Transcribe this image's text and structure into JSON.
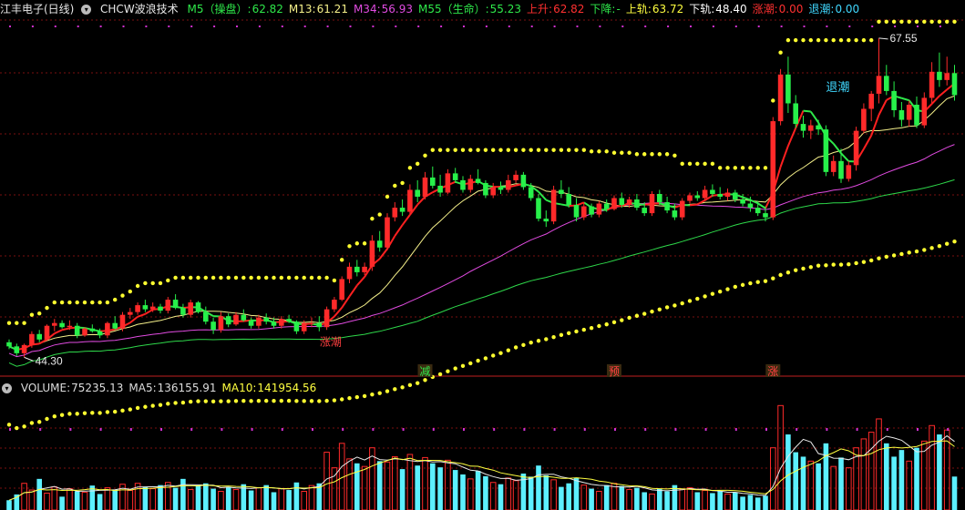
{
  "header": {
    "stock_name": "江丰电子(日线)",
    "indicator_name": "CHCW波浪技术",
    "items": [
      {
        "label": "M5（操盘）:",
        "value": "62.82",
        "color": "#2ee84a"
      },
      {
        "label": "M13:",
        "value": "61.21",
        "color": "#f5f08a"
      },
      {
        "label": "M34:",
        "value": "56.93",
        "color": "#e14be1"
      },
      {
        "label": "M55（生命）:",
        "value": "55.23",
        "color": "#2ee84a"
      },
      {
        "label": "上升:",
        "value": "62.82",
        "color": "#ff3030"
      },
      {
        "label": "下降:",
        "value": "-",
        "color": "#2ee84a"
      },
      {
        "label": "上轨:",
        "value": "63.72",
        "color": "#ffff40"
      },
      {
        "label": "下轨:",
        "value": "48.40",
        "color": "#ffffff"
      },
      {
        "label": "涨潮:",
        "value": "0.00",
        "color": "#ff3030"
      },
      {
        "label": "退潮:",
        "value": "0.00",
        "color": "#40d8ff"
      }
    ]
  },
  "volume_header": {
    "items": [
      {
        "label": "VOLUME:",
        "value": "75235.13",
        "color": "#dddddd"
      },
      {
        "label": "MA5:",
        "value": "136155.91",
        "color": "#dddddd"
      },
      {
        "label": "MA10:",
        "value": "141954.56",
        "color": "#ffff40"
      }
    ]
  },
  "annotations": {
    "high": "67.55",
    "low": "44.30",
    "tide_out": "退潮",
    "tide_in": "涨潮",
    "markers": [
      {
        "text": "减",
        "color": "#2ee84a",
        "index": 55
      },
      {
        "text": "预",
        "color": "#ff4040",
        "index": 80
      },
      {
        "text": "涨",
        "color": "#ff4040",
        "index": 101
      }
    ]
  },
  "colors": {
    "up": "#ff2a2a",
    "down": "#27f04a",
    "vol_up": "#ff2a2a",
    "vol_down": "#5cf0ff",
    "grid": "#7a1010"
  },
  "chart_data": {
    "type": "candlestick",
    "ylim": [
      43,
      69
    ],
    "volume_ylim": [
      0,
      250000
    ],
    "ohlc": [
      [
        45.4,
        45.6,
        44.9,
        45.1
      ],
      [
        45.1,
        45.3,
        44.4,
        44.6
      ],
      [
        44.6,
        45.3,
        44.3,
        45.2
      ],
      [
        45.2,
        46.2,
        45.0,
        46.0
      ],
      [
        46.0,
        46.3,
        45.4,
        45.6
      ],
      [
        45.6,
        46.7,
        45.5,
        46.6
      ],
      [
        46.6,
        47.1,
        46.2,
        46.8
      ],
      [
        46.8,
        47.0,
        46.4,
        46.5
      ],
      [
        46.5,
        47.0,
        46.3,
        46.6
      ],
      [
        46.6,
        46.8,
        45.7,
        45.9
      ],
      [
        45.9,
        46.5,
        45.8,
        46.4
      ],
      [
        46.4,
        46.7,
        46.1,
        46.2
      ],
      [
        46.2,
        46.4,
        45.7,
        45.9
      ],
      [
        45.9,
        46.9,
        45.7,
        46.8
      ],
      [
        46.8,
        47.3,
        46.3,
        46.4
      ],
      [
        46.4,
        47.6,
        46.2,
        47.4
      ],
      [
        47.4,
        47.9,
        47.1,
        47.6
      ],
      [
        47.6,
        48.3,
        47.4,
        48.1
      ],
      [
        48.1,
        48.5,
        47.6,
        47.8
      ],
      [
        47.8,
        48.3,
        47.6,
        48.0
      ],
      [
        48.0,
        48.2,
        47.5,
        47.7
      ],
      [
        47.7,
        48.7,
        47.5,
        48.5
      ],
      [
        48.5,
        48.9,
        47.8,
        47.9
      ],
      [
        47.9,
        48.2,
        47.2,
        47.4
      ],
      [
        47.4,
        48.5,
        47.2,
        48.3
      ],
      [
        48.3,
        48.4,
        47.5,
        47.6
      ],
      [
        47.6,
        48.0,
        46.7,
        46.9
      ],
      [
        46.9,
        47.2,
        46.0,
        46.3
      ],
      [
        46.3,
        47.6,
        46.1,
        47.3
      ],
      [
        47.3,
        47.5,
        46.5,
        46.7
      ],
      [
        46.7,
        47.6,
        46.6,
        47.4
      ],
      [
        47.4,
        47.8,
        46.9,
        47.0
      ],
      [
        47.0,
        47.2,
        46.4,
        46.6
      ],
      [
        46.6,
        47.4,
        46.4,
        47.2
      ],
      [
        47.2,
        47.5,
        46.7,
        46.9
      ],
      [
        46.9,
        47.2,
        46.4,
        46.6
      ],
      [
        46.6,
        47.3,
        46.4,
        47.1
      ],
      [
        47.1,
        47.4,
        46.8,
        46.9
      ],
      [
        46.9,
        47.0,
        46.0,
        46.2
      ],
      [
        46.2,
        47.0,
        46.0,
        46.8
      ],
      [
        46.8,
        47.2,
        46.5,
        46.8
      ],
      [
        46.8,
        47.3,
        46.2,
        46.5
      ],
      [
        46.5,
        48.0,
        46.3,
        47.8
      ],
      [
        47.8,
        48.7,
        47.6,
        48.5
      ],
      [
        48.5,
        50.2,
        48.4,
        50.0
      ],
      [
        50.0,
        51.2,
        49.7,
        50.9
      ],
      [
        50.9,
        51.4,
        50.2,
        50.5
      ],
      [
        50.5,
        51.2,
        50.3,
        50.9
      ],
      [
        50.9,
        53.2,
        50.6,
        52.8
      ],
      [
        52.8,
        53.5,
        52.0,
        52.3
      ],
      [
        52.3,
        54.8,
        52.1,
        54.5
      ],
      [
        54.5,
        55.6,
        54.2,
        55.2
      ],
      [
        55.2,
        55.8,
        54.6,
        54.9
      ],
      [
        54.9,
        56.9,
        54.7,
        56.5
      ],
      [
        56.5,
        57.2,
        55.6,
        56.0
      ],
      [
        56.0,
        57.8,
        55.8,
        57.4
      ],
      [
        57.4,
        58.2,
        56.6,
        56.8
      ],
      [
        56.8,
        57.6,
        56.0,
        56.3
      ],
      [
        56.3,
        58.0,
        56.2,
        57.7
      ],
      [
        57.7,
        58.1,
        57.0,
        57.2
      ],
      [
        57.2,
        57.5,
        56.3,
        56.5
      ],
      [
        56.5,
        57.6,
        56.3,
        57.3
      ],
      [
        57.3,
        58.0,
        56.9,
        57.0
      ],
      [
        57.0,
        57.2,
        55.9,
        56.1
      ],
      [
        56.1,
        57.0,
        55.9,
        56.7
      ],
      [
        56.7,
        57.1,
        56.2,
        56.5
      ],
      [
        56.5,
        57.6,
        56.3,
        57.2
      ],
      [
        57.2,
        57.9,
        57.0,
        57.6
      ],
      [
        57.6,
        57.8,
        56.5,
        56.7
      ],
      [
        56.7,
        57.0,
        55.7,
        55.9
      ],
      [
        55.9,
        56.2,
        54.2,
        54.4
      ],
      [
        54.4,
        55.0,
        53.8,
        54.2
      ],
      [
        54.2,
        56.8,
        54.0,
        56.5
      ],
      [
        56.5,
        57.2,
        55.9,
        56.2
      ],
      [
        56.2,
        56.7,
        55.2,
        55.4
      ],
      [
        55.4,
        55.9,
        54.2,
        54.5
      ],
      [
        54.5,
        55.6,
        54.3,
        55.3
      ],
      [
        55.3,
        55.5,
        54.5,
        54.7
      ],
      [
        54.7,
        55.7,
        54.5,
        55.5
      ],
      [
        55.5,
        55.8,
        54.9,
        55.1
      ],
      [
        55.1,
        56.1,
        55.0,
        55.9
      ],
      [
        55.9,
        56.3,
        55.2,
        55.4
      ],
      [
        55.4,
        56.0,
        55.2,
        55.8
      ],
      [
        55.8,
        56.2,
        55.0,
        55.2
      ],
      [
        55.2,
        55.6,
        54.6,
        54.8
      ],
      [
        54.8,
        56.4,
        54.6,
        56.2
      ],
      [
        56.2,
        56.5,
        55.4,
        55.6
      ],
      [
        55.6,
        56.0,
        54.8,
        55.0
      ],
      [
        55.0,
        55.5,
        54.3,
        54.5
      ],
      [
        54.5,
        55.9,
        54.3,
        55.7
      ],
      [
        55.7,
        56.3,
        55.5,
        56.1
      ],
      [
        56.1,
        56.4,
        55.7,
        55.9
      ],
      [
        55.9,
        56.8,
        55.7,
        56.5
      ],
      [
        56.5,
        56.9,
        56.0,
        56.2
      ],
      [
        56.2,
        56.7,
        55.8,
        56.0
      ],
      [
        56.0,
        56.6,
        55.7,
        56.3
      ],
      [
        56.3,
        56.5,
        55.6,
        55.8
      ],
      [
        55.8,
        56.2,
        55.3,
        55.5
      ],
      [
        55.5,
        56.0,
        54.9,
        55.2
      ],
      [
        55.2,
        55.7,
        54.6,
        54.8
      ],
      [
        54.8,
        55.3,
        54.2,
        54.5
      ],
      [
        54.5,
        61.8,
        54.3,
        61.5
      ],
      [
        61.5,
        65.3,
        61.2,
        64.9
      ],
      [
        64.9,
        66.2,
        62.1,
        62.8
      ],
      [
        62.8,
        63.4,
        61.0,
        61.3
      ],
      [
        61.3,
        61.9,
        60.3,
        60.8
      ],
      [
        60.8,
        61.6,
        60.2,
        61.2
      ],
      [
        61.2,
        61.6,
        60.5,
        60.9
      ],
      [
        60.9,
        61.2,
        57.5,
        57.8
      ],
      [
        57.8,
        59.0,
        57.5,
        58.6
      ],
      [
        58.6,
        59.5,
        57.0,
        57.3
      ],
      [
        57.3,
        58.6,
        57.1,
        58.3
      ],
      [
        58.3,
        61.1,
        57.9,
        60.8
      ],
      [
        60.8,
        62.8,
        60.6,
        62.4
      ],
      [
        62.4,
        63.7,
        61.5,
        63.5
      ],
      [
        63.5,
        67.55,
        62.8,
        64.8
      ],
      [
        64.8,
        65.6,
        63.4,
        63.7
      ],
      [
        63.7,
        64.4,
        61.8,
        62.3
      ],
      [
        62.3,
        62.9,
        61.1,
        61.6
      ],
      [
        61.6,
        63.0,
        61.1,
        62.7
      ],
      [
        62.7,
        63.3,
        61.0,
        61.2
      ],
      [
        61.2,
        63.6,
        61.0,
        63.2
      ],
      [
        63.2,
        65.8,
        62.8,
        65.1
      ],
      [
        65.1,
        66.5,
        64.0,
        64.5
      ],
      [
        64.5,
        66.2,
        64.1,
        65.0
      ],
      [
        65.0,
        65.6,
        63.0,
        63.4
      ]
    ],
    "volume": [
      22000,
      35000,
      60000,
      45000,
      70000,
      38000,
      52000,
      30000,
      48000,
      42000,
      40000,
      55000,
      36000,
      50000,
      46000,
      58000,
      44000,
      60000,
      52000,
      48000,
      56000,
      62000,
      50000,
      70000,
      46000,
      55000,
      60000,
      48000,
      42000,
      52000,
      46000,
      58000,
      44000,
      50000,
      56000,
      40000,
      48000,
      45000,
      62000,
      42000,
      55000,
      60000,
      130000,
      95000,
      150000,
      115000,
      105000,
      98000,
      140000,
      110000,
      108000,
      120000,
      92000,
      125000,
      100000,
      118000,
      105000,
      96000,
      112000,
      90000,
      80000,
      70000,
      88000,
      76000,
      62000,
      58000,
      72000,
      66000,
      82000,
      75000,
      100000,
      78000,
      68000,
      52000,
      60000,
      72000,
      56000,
      48000,
      42000,
      56000,
      60000,
      54000,
      46000,
      50000,
      40000,
      36000,
      48000,
      42000,
      56000,
      46000,
      50000,
      40000,
      44000,
      38000,
      42000,
      36000,
      40000,
      30000,
      34000,
      28000,
      32000,
      140000,
      235000,
      170000,
      130000,
      120000,
      110000,
      105000,
      150000,
      98000,
      118000,
      95000,
      140000,
      160000,
      175000,
      205000,
      150000,
      120000,
      135000,
      110000,
      140000,
      155000,
      190000,
      170000,
      180000,
      75235
    ]
  }
}
